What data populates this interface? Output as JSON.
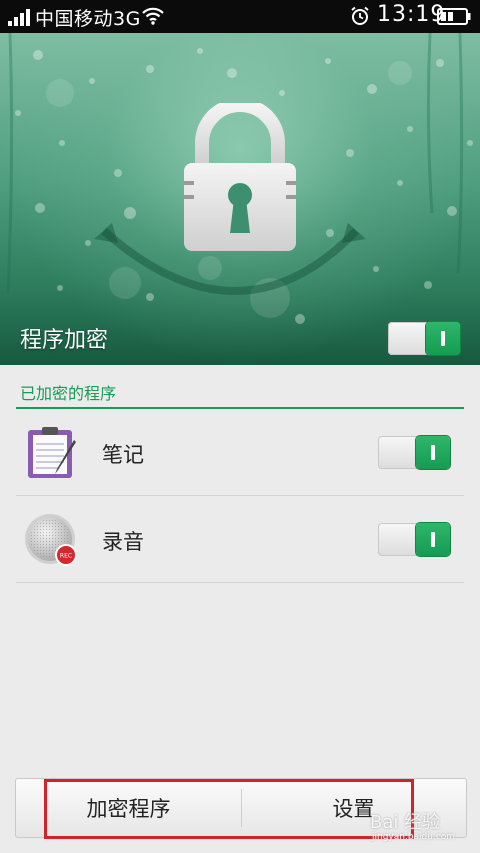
{
  "status_bar": {
    "carrier": "中国移动3G",
    "time": "13:19"
  },
  "hero": {
    "title": "程序加密",
    "toggle_on": true
  },
  "section": {
    "title": "已加密的程序"
  },
  "apps": [
    {
      "label": "笔记",
      "icon": "notes-clipboard-icon",
      "toggle_on": true
    },
    {
      "label": "录音",
      "icon": "recorder-rec-icon",
      "toggle_on": true
    }
  ],
  "bottom_bar": {
    "encrypt_label": "加密程序",
    "settings_label": "设置"
  },
  "watermark": {
    "text": "Bai 经验",
    "sub": "jingyan.baidu.com"
  },
  "colors": {
    "accent": "#1a9a55",
    "highlight": "#d2232a"
  }
}
